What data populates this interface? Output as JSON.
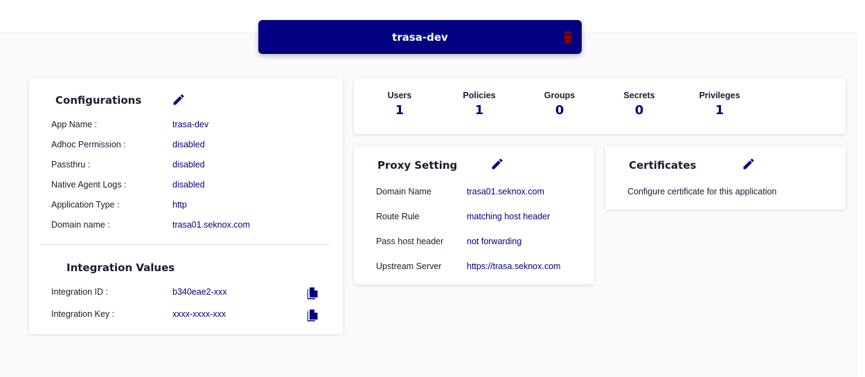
{
  "app": {
    "title": "trasa-dev"
  },
  "configurations": {
    "title": "Configurations",
    "rows": [
      {
        "label": "App Name :",
        "value": "trasa-dev"
      },
      {
        "label": "Adhoc Permission :",
        "value": "disabled"
      },
      {
        "label": "Passthru :",
        "value": "disabled"
      },
      {
        "label": "Native Agent Logs :",
        "value": "disabled"
      },
      {
        "label": "Application Type :",
        "value": "http"
      },
      {
        "label": "Domain name :",
        "value": "trasa01.seknox.com"
      }
    ]
  },
  "integration": {
    "title": "Integration Values",
    "rows": [
      {
        "label": "Integration ID :",
        "value": "b340eae2-xxx"
      },
      {
        "label": "Integration Key :",
        "value": "xxxx-xxxx-xxx"
      }
    ]
  },
  "stats": [
    {
      "label": "Users",
      "value": "1"
    },
    {
      "label": "Policies",
      "value": "1"
    },
    {
      "label": "Groups",
      "value": "0"
    },
    {
      "label": "Secrets",
      "value": "0"
    },
    {
      "label": "Privileges",
      "value": "1"
    }
  ],
  "proxy": {
    "title": "Proxy Setting",
    "rows": [
      {
        "label": "Domain Name",
        "value": "trasa01.seknox.com"
      },
      {
        "label": "Route Rule",
        "value": "matching host header"
      },
      {
        "label": "Pass host header",
        "value": "not forwarding"
      },
      {
        "label": "Upstream Server",
        "value": "https://trasa.seknox.com"
      }
    ]
  },
  "certificates": {
    "title": "Certificates",
    "description": "Configure certificate for this application"
  },
  "colors": {
    "accent": "#000080",
    "delete": "#8b0000"
  },
  "icons": {
    "edit": "pencil-icon",
    "delete": "trash-icon",
    "copy": "copy-icon"
  }
}
